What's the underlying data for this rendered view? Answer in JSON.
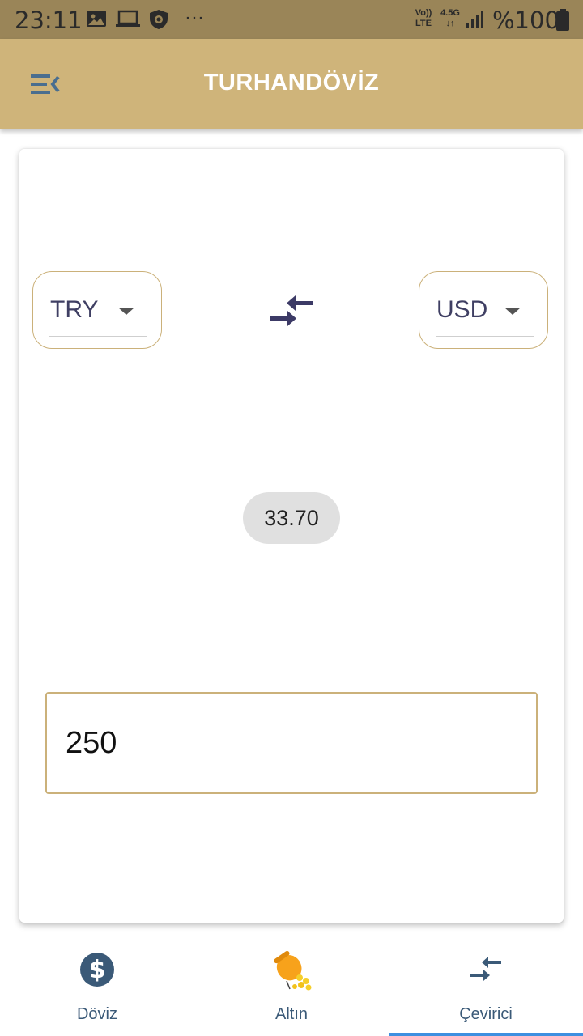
{
  "status_bar": {
    "time": "23:11",
    "more": "···",
    "volte_top": "Vo))",
    "volte_bottom": "LTE",
    "network_top": "4.5G",
    "network_bottom": "↓↑",
    "battery": "%100",
    "icons": [
      "gallery-icon",
      "laptop-icon",
      "shield-icon",
      "volte-icon",
      "network-4-5g-icon",
      "signal-icon",
      "battery-icon"
    ]
  },
  "app_bar": {
    "title": "TURHANDÖVİZ",
    "menu_icon": "menu-collapse-icon"
  },
  "converter": {
    "from_currency": "TRY",
    "to_currency": "USD",
    "swap_icon": "swap-arrows-icon",
    "result": "33.70",
    "amount": "250"
  },
  "bottom_nav": {
    "items": [
      {
        "label": "Döviz",
        "icon": "dollar-coin-icon",
        "active": false
      },
      {
        "label": "Altın",
        "icon": "gold-pot-icon",
        "active": false
      },
      {
        "label": "Çevirici",
        "icon": "swap-arrows-icon",
        "active": true
      }
    ]
  },
  "colors": {
    "status_bar": "#9a8558",
    "app_bar": "#cfb47a",
    "accent_border": "#cbb17a",
    "swap_icon": "#3c3a66",
    "nav_icon": "#3b5a78",
    "active_indicator": "#3d8fe0"
  }
}
